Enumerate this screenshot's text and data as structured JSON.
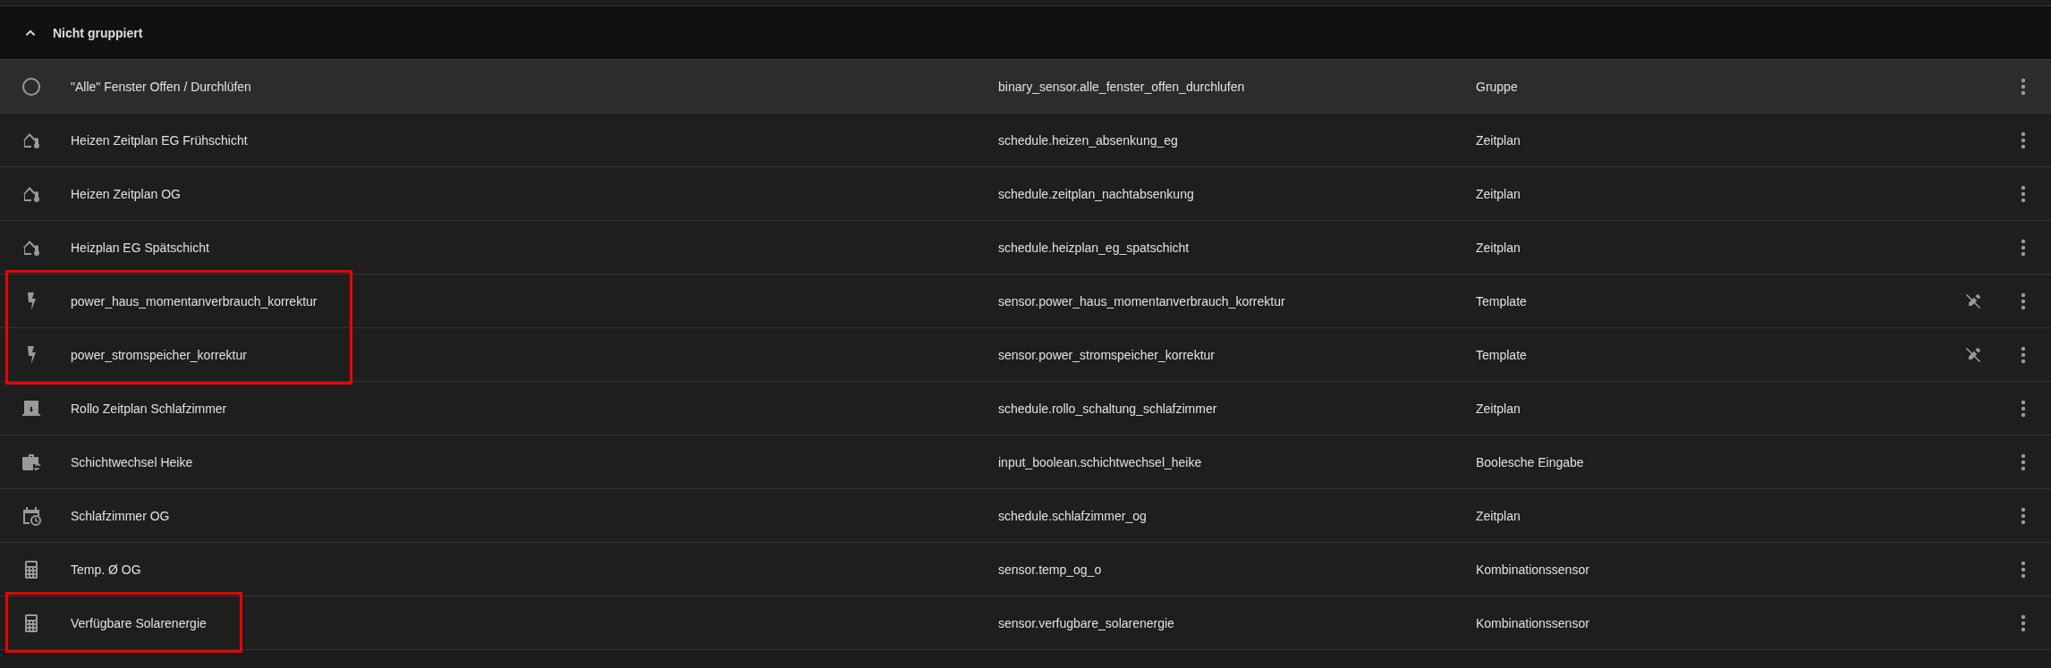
{
  "group": {
    "title": "Nicht gruppiert",
    "expanded": true
  },
  "rows": [
    {
      "kind": "circle",
      "name": "\"Alle\" Fenster Offen / Durchlüfen",
      "entity_id": "binary_sensor.alle_fenster_offen_durchlufen",
      "type": "Gruppe",
      "read_only": false,
      "hovered": true,
      "marked": false
    },
    {
      "kind": "thermostat",
      "name": "Heizen Zeitplan EG Frühschicht",
      "entity_id": "schedule.heizen_absenkung_eg",
      "type": "Zeitplan",
      "read_only": false,
      "hovered": false,
      "marked": false
    },
    {
      "kind": "thermostat",
      "name": "Heizen Zeitplan OG",
      "entity_id": "schedule.zeitplan_nachtabsenkung",
      "type": "Zeitplan",
      "read_only": false,
      "hovered": false,
      "marked": false
    },
    {
      "kind": "thermostat",
      "name": "Heizplan EG Spätschicht",
      "entity_id": "schedule.heizplan_eg_spatschicht",
      "type": "Zeitplan",
      "read_only": false,
      "hovered": false,
      "marked": false
    },
    {
      "kind": "power",
      "name": "power_haus_momentanverbrauch_korrektur",
      "entity_id": "sensor.power_haus_momentanverbrauch_korrektur",
      "type": "Template",
      "read_only": true,
      "hovered": false,
      "marked": true
    },
    {
      "kind": "power",
      "name": "power_stromspeicher_korrektur",
      "entity_id": "sensor.power_stromspeicher_korrektur",
      "type": "Template",
      "read_only": true,
      "hovered": false,
      "marked": true
    },
    {
      "kind": "shutter",
      "name": "Rollo Zeitplan Schlafzimmer",
      "entity_id": "schedule.rollo_schaltung_schlafzimmer",
      "type": "Zeitplan",
      "read_only": false,
      "hovered": false,
      "marked": false
    },
    {
      "kind": "shift",
      "name": "Schichtwechsel Heike",
      "entity_id": "input_boolean.schichtwechsel_heike",
      "type": "Boolesche Eingabe",
      "read_only": false,
      "hovered": false,
      "marked": false
    },
    {
      "kind": "schedule",
      "name": "Schlafzimmer OG",
      "entity_id": "schedule.schlafzimmer_og",
      "type": "Zeitplan",
      "read_only": false,
      "hovered": false,
      "marked": false
    },
    {
      "kind": "combination",
      "name": "Temp. Ø OG",
      "entity_id": "sensor.temp_og_o",
      "type": "Kombinationssensor",
      "read_only": false,
      "hovered": false,
      "marked": false
    },
    {
      "kind": "combination",
      "name": "Verfügbare Solarenergie",
      "entity_id": "sensor.verfugbare_solarenergie",
      "type": "Kombinationssensor",
      "read_only": false,
      "hovered": false,
      "marked": true
    }
  ]
}
